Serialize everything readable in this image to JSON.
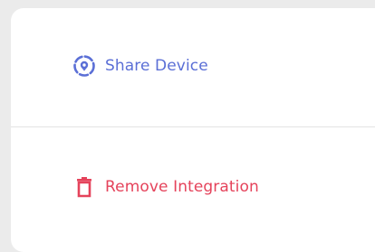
{
  "menu": {
    "share": {
      "label": "Share Device",
      "icon": "location-share-icon",
      "color": "#5b6fd6"
    },
    "remove": {
      "label": "Remove Integration",
      "icon": "trash-icon",
      "color": "#e5435b"
    }
  }
}
